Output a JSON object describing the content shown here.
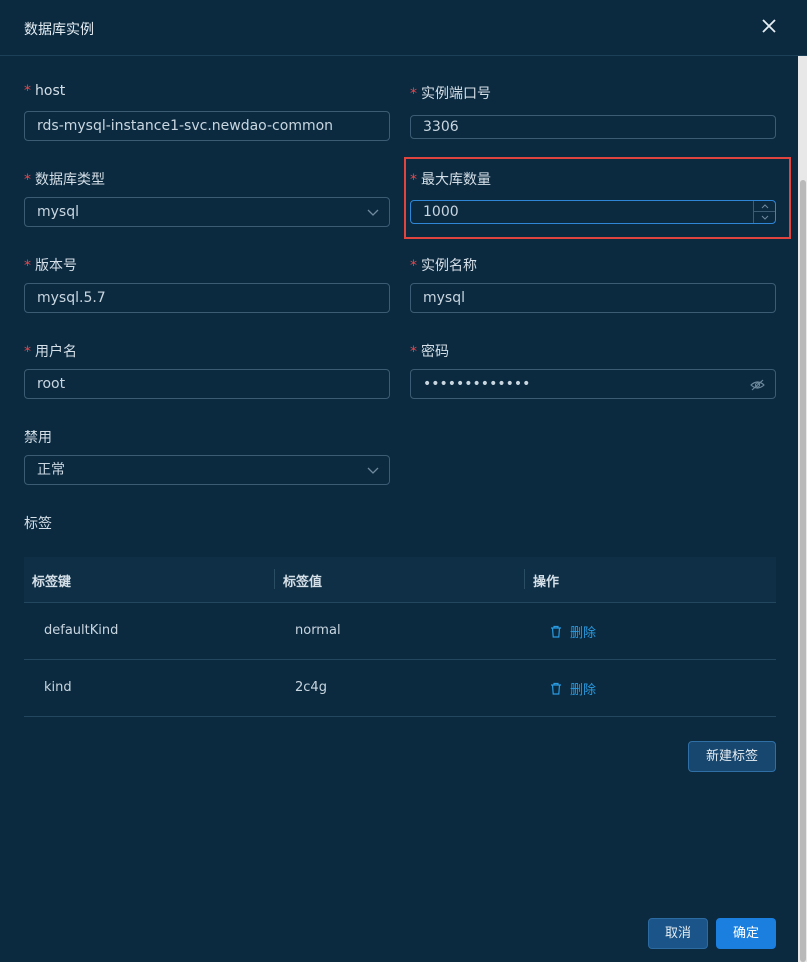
{
  "dialog": {
    "title": "数据库实例"
  },
  "form": {
    "host": {
      "label": "host",
      "value": "rds-mysql-instance1-svc.newdao-common"
    },
    "port": {
      "label": "实例端口号",
      "value": "3306"
    },
    "db_type": {
      "label": "数据库类型",
      "value": "mysql"
    },
    "max_db": {
      "label": "最大库数量",
      "value": "1000"
    },
    "version": {
      "label": "版本号",
      "value": "mysql.5.7"
    },
    "instance_name": {
      "label": "实例名称",
      "value": "mysql"
    },
    "username": {
      "label": "用户名",
      "value": "root"
    },
    "password": {
      "label": "密码",
      "value": "•••••••••••••"
    },
    "disabled": {
      "label": "禁用",
      "value": "正常"
    },
    "tags_label": "标签",
    "required_mark": "*"
  },
  "tags_table": {
    "headers": [
      "标签键",
      "标签值",
      "操作"
    ],
    "rows": [
      {
        "key": "defaultKind",
        "value": "normal",
        "action": "删除"
      },
      {
        "key": "kind",
        "value": "2c4g",
        "action": "删除"
      }
    ]
  },
  "buttons": {
    "new_tag": "新建标签",
    "cancel": "取消",
    "confirm": "确定"
  },
  "colors": {
    "background": "#0b2a40",
    "accent": "#1b7fe0",
    "danger": "#e5484d",
    "link": "#2a9be0",
    "highlight": "#e0443e"
  }
}
